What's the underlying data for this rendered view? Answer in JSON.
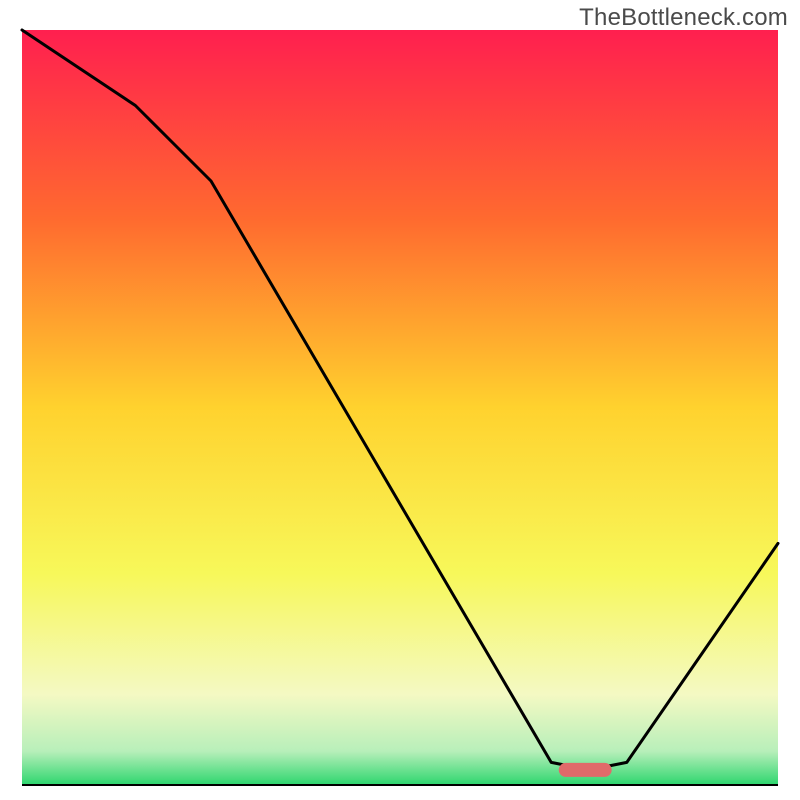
{
  "watermark": "TheBottleneck.com",
  "chart_data": {
    "type": "line",
    "title": "",
    "xlabel": "",
    "ylabel": "",
    "xlim": [
      0,
      100
    ],
    "ylim": [
      0,
      100
    ],
    "x": [
      0,
      15,
      25,
      70,
      75,
      80,
      100
    ],
    "values": [
      100,
      90,
      80,
      3,
      2,
      3,
      32
    ],
    "optimal_marker": {
      "x_start": 71,
      "x_end": 78,
      "y": 2
    },
    "background": {
      "type": "vertical-gradient",
      "stops": [
        {
          "pos": 0.0,
          "color": "#ff1f4f"
        },
        {
          "pos": 0.25,
          "color": "#ff6a2f"
        },
        {
          "pos": 0.5,
          "color": "#ffd22e"
        },
        {
          "pos": 0.72,
          "color": "#f7f85a"
        },
        {
          "pos": 0.88,
          "color": "#f4f9c3"
        },
        {
          "pos": 0.955,
          "color": "#b8efba"
        },
        {
          "pos": 1.0,
          "color": "#2dd66e"
        }
      ]
    },
    "axes_visible": false,
    "grid": false,
    "legend": false
  }
}
